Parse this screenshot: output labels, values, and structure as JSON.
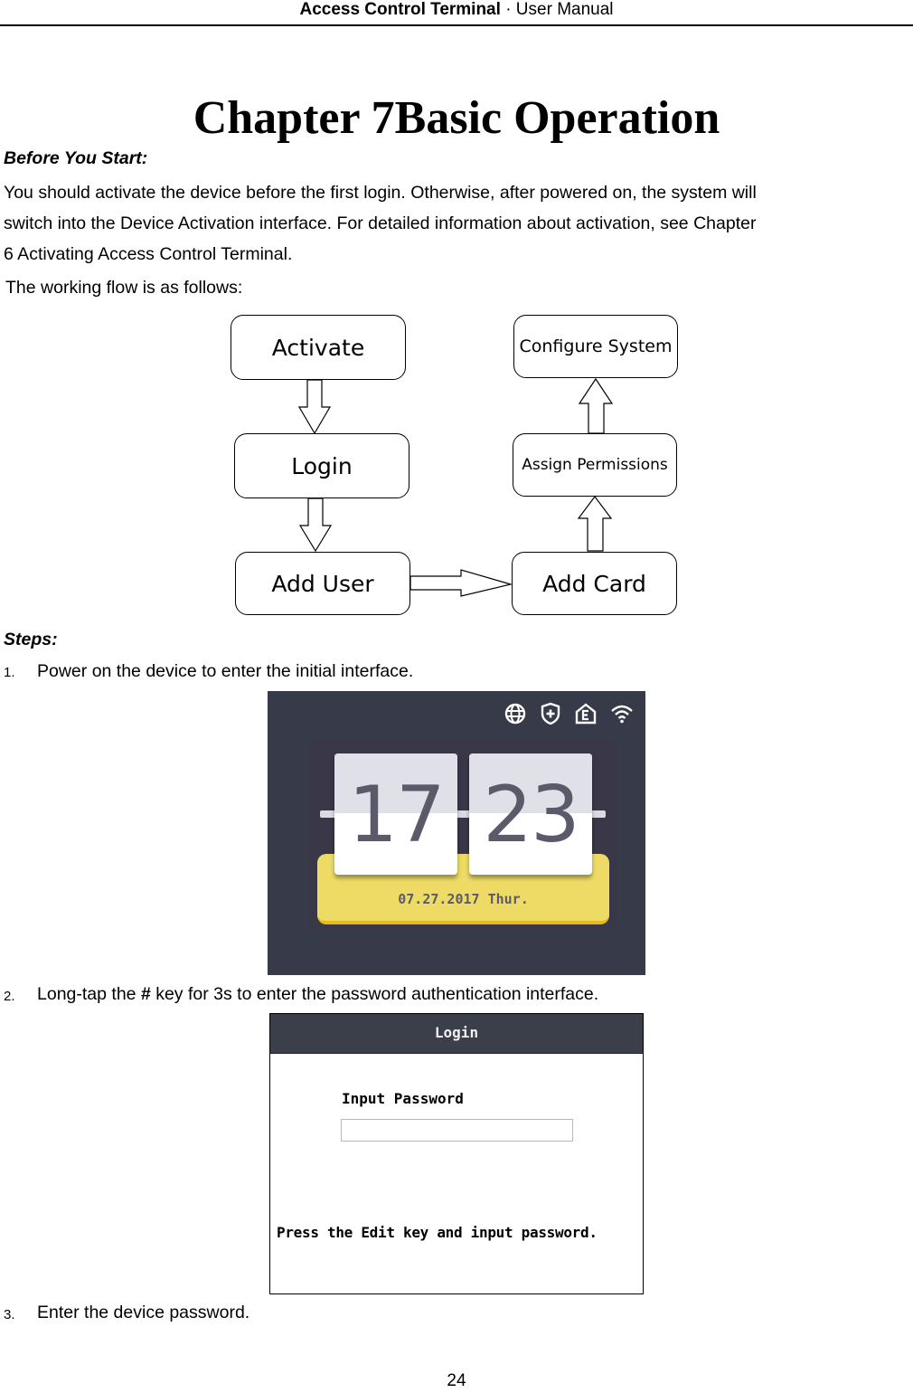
{
  "header": {
    "product": "Access Control Terminal",
    "separator": "·",
    "doc_type": "User Manual"
  },
  "chapter_title": "Chapter 7Basic Operation",
  "before_you_start": {
    "label": "Before You Start:",
    "lines": [
      "You should activate the device before the first login. Otherwise, after powered on, the system will",
      "switch into the Device Activation interface. For detailed information about activation, see Chapter",
      "6 Activating Access Control Terminal."
    ]
  },
  "flow_intro": "The working flow is as follows:",
  "flowchart": {
    "nodes": [
      "Activate",
      "Login",
      "Add User",
      "Add Card",
      "Assign Permissions",
      "Configure System"
    ],
    "edges": [
      [
        "Activate",
        "Login"
      ],
      [
        "Login",
        "Add User"
      ],
      [
        "Add User",
        "Add Card"
      ],
      [
        "Add Card",
        "Assign Permissions"
      ],
      [
        "Assign Permissions",
        "Configure System"
      ]
    ]
  },
  "steps_label": "Steps:",
  "steps": [
    {
      "num": "1.",
      "text": "Power on the device to enter the initial interface."
    },
    {
      "num": "2.",
      "pre": "Long-tap the ",
      "key": "#",
      "post": " key for 3s to enter the password authentication interface."
    },
    {
      "num": "3.",
      "text": "Enter the device password."
    }
  ],
  "initial_screen": {
    "status_icons": [
      "globe-icon",
      "shield-plus-icon",
      "home-e-icon",
      "wifi-icon"
    ],
    "hour": "17",
    "minute": "23",
    "date": "07.27.2017 Thur."
  },
  "login_screen": {
    "title": "Login",
    "field_label": "Input Password",
    "password_value": "",
    "hint": "Press the Edit key and input password."
  },
  "page_number": "24"
}
